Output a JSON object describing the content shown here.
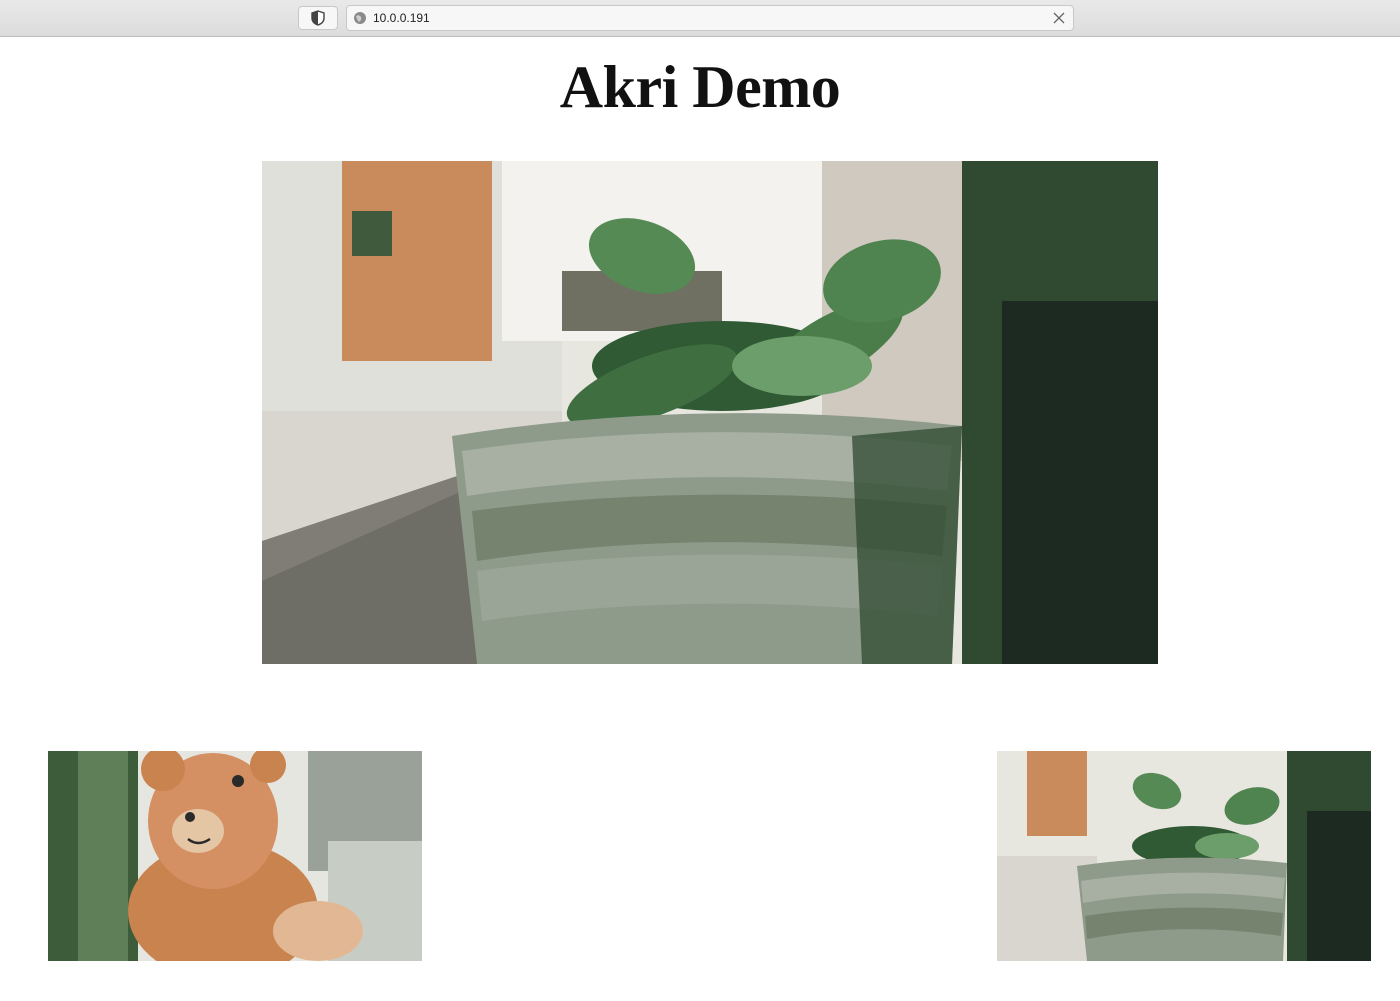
{
  "browser": {
    "url": "10.0.0.191",
    "shield_icon": "shield-icon",
    "site_icon": "globe-icon",
    "close_icon": "close-icon"
  },
  "page": {
    "title": "Akri Demo"
  },
  "feeds": [
    {
      "subject": "potted plant in woven basket",
      "size": "large"
    },
    {
      "subject": "teddy bear",
      "size": "small"
    },
    {
      "subject": "potted plant in woven basket",
      "size": "small"
    }
  ],
  "colors": {
    "title": "#111111",
    "foliage": "#4e8a4e",
    "basket": "#8e9a8a",
    "bear": "#d08a5a"
  }
}
